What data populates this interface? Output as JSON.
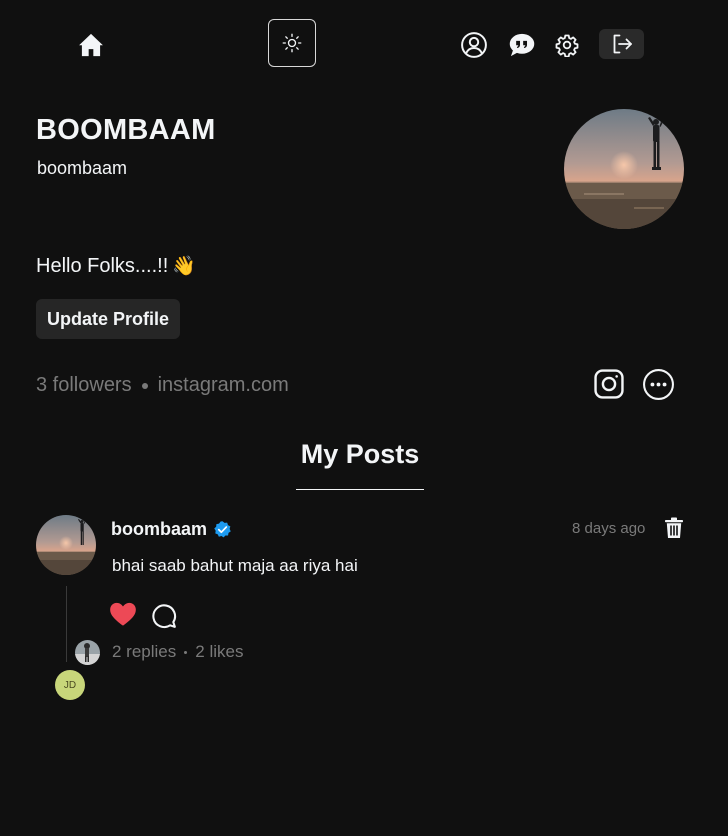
{
  "nav": {
    "home_icon": "home-icon",
    "theme_icon": "sun-icon",
    "profile_icon": "user-circle-icon",
    "chat_icon": "chat-bubbles-icon",
    "settings_icon": "gear-icon",
    "logout_icon": "logout-icon"
  },
  "profile": {
    "name": "BOOMBAAM",
    "username": "boombaam",
    "bio": "Hello Folks....!!",
    "bio_emoji": "👋",
    "update_button": "Update Profile",
    "followers": "3 followers",
    "link": "instagram.com"
  },
  "tabs": {
    "my_posts": "My Posts"
  },
  "post": {
    "author": "boombaam",
    "time": "8 days ago",
    "text": "bhai saab bahut maja aa riya hai",
    "replies": "2 replies",
    "likes": "2 likes",
    "liked": true,
    "reply_avatar_initials": "JD"
  },
  "colors": {
    "background": "#101010",
    "text": "#f3f5f7",
    "muted": "#7a7a7a",
    "like": "#ed4956",
    "verified": "#1d9bf0"
  }
}
